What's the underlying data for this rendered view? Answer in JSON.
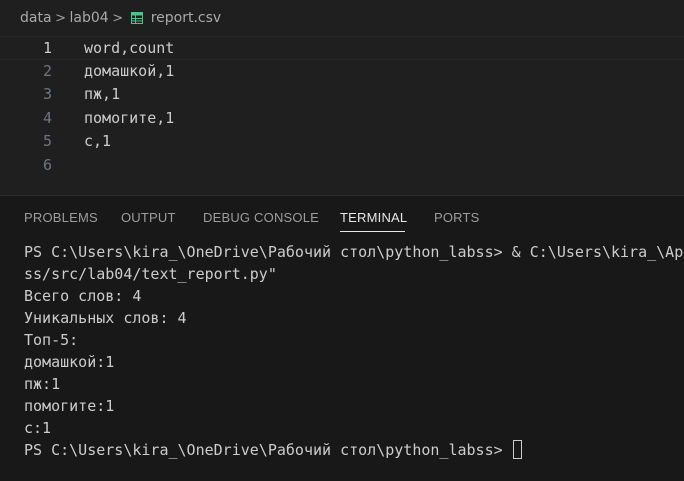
{
  "breadcrumb": {
    "items": [
      "data",
      "lab04"
    ],
    "file": "report.csv",
    "separator": ">",
    "file_icon": "table-icon"
  },
  "editor": {
    "lines": [
      {
        "number": "1",
        "text": "word,count"
      },
      {
        "number": "2",
        "text": "домашкой,1"
      },
      {
        "number": "3",
        "text": "пж,1"
      },
      {
        "number": "4",
        "text": "помогите,1"
      },
      {
        "number": "5",
        "text": "с,1"
      },
      {
        "number": "6",
        "text": ""
      }
    ]
  },
  "panel": {
    "tabs": [
      "PROBLEMS",
      "OUTPUT",
      "DEBUG CONSOLE",
      "TERMINAL",
      "PORTS"
    ],
    "active_tab": "TERMINAL"
  },
  "terminal": {
    "lines": [
      "PS C:\\Users\\kira_\\OneDrive\\Рабочий стол\\python_labss> & C:\\Users\\kira_\\App",
      "ss/src/lab04/text_report.py\"",
      "Всего слов: 4",
      "Уникальных слов: 4",
      "Топ-5:",
      "домашкой:1",
      "пж:1",
      "помогите:1",
      "с:1"
    ],
    "prompt": "PS C:\\Users\\kira_\\OneDrive\\Рабочий стол\\python_labss> "
  },
  "colors": {
    "background": "#1f1f1f",
    "panel_background": "#181818",
    "text": "#cccccc",
    "line_number": "#6e7681",
    "csv_icon": "#4ec28a"
  }
}
